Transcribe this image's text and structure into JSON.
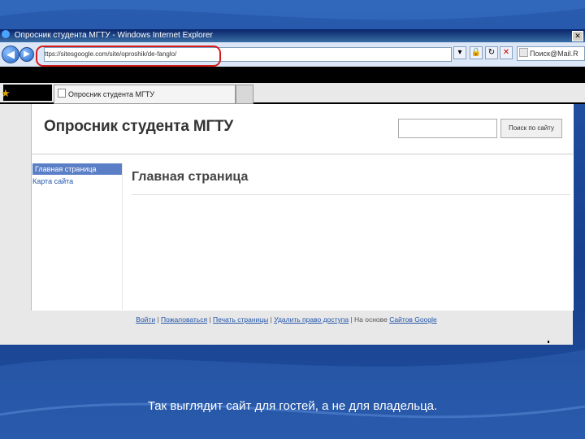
{
  "browser": {
    "window_title": "Опросник студента МГТУ - Windows Internet Explorer",
    "address_url": "ttps://sitesgoogle.com/site/oproshik/de-fanglo/",
    "search_placeholder": "Поиск@Mail.R",
    "tab_title": "Опросник студента МГТУ",
    "nav_back": "◀",
    "nav_forward": "▶",
    "close_glyph": "✕"
  },
  "site": {
    "title": "Опросник студента МГТУ",
    "search_button": "Поиск по сайту",
    "sidebar": {
      "items": [
        "Главная страница",
        "Карта сайта"
      ]
    },
    "page_heading": "Главная страница",
    "footer": {
      "links": [
        "Войти",
        "Пожаловаться",
        "Печать страницы",
        "Удалить право доступа"
      ],
      "separator": " | ",
      "powered_prefix": "На основе",
      "powered_link": "Сайтов Google"
    }
  },
  "slide": {
    "caption": "Так выглядит сайт для гостей, а не для владельца."
  },
  "colors": {
    "slide_bg": "#1d4a9c",
    "highlight_oval": "#d41c1c",
    "nav_active": "#5b7fc7",
    "link": "#2255aa"
  }
}
